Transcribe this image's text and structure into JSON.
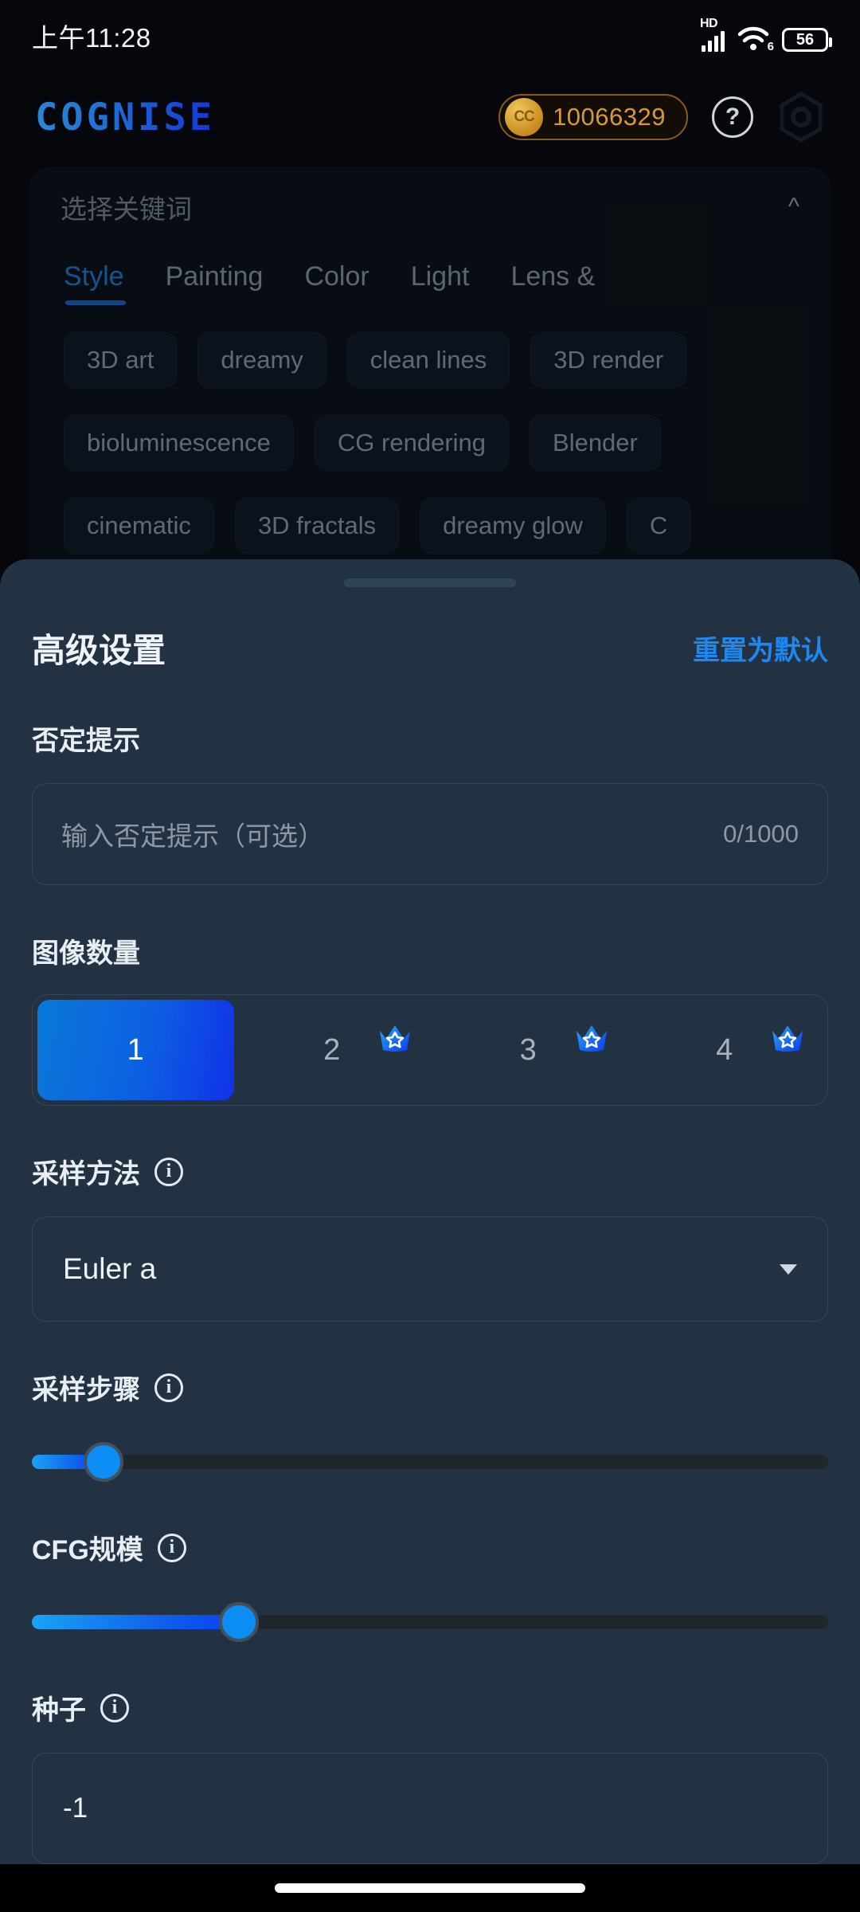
{
  "status_bar": {
    "time": "上午11:28",
    "network_label": "HD",
    "wifi_generation": "6",
    "battery_percent": "56"
  },
  "app_bar": {
    "logo": "COGNISE",
    "coin_icon_label": "CC",
    "coin_balance": "10066329",
    "help_label": "?",
    "icons": [
      "coin-icon",
      "help-icon",
      "settings-hex-icon"
    ]
  },
  "background_panel": {
    "title": "选择关键词",
    "collapse_icon": "chevron-up-icon",
    "tabs": [
      {
        "label": "Style",
        "active": true
      },
      {
        "label": "Painting",
        "active": false
      },
      {
        "label": "Color",
        "active": false
      },
      {
        "label": "Light",
        "active": false
      },
      {
        "label": "Lens &",
        "active": false
      }
    ],
    "chip_rows": [
      [
        "3D art",
        "dreamy",
        "clean lines",
        "3D render"
      ],
      [
        "bioluminescence",
        "CG rendering",
        "Blender"
      ],
      [
        "cinematic",
        "3D fractals",
        "dreamy glow",
        "C"
      ]
    ]
  },
  "sheet": {
    "title": "高级设置",
    "reset_label": "重置为默认",
    "negative_prompt": {
      "label": "否定提示",
      "placeholder": "输入否定提示（可选）",
      "counter": "0/1000",
      "value": ""
    },
    "image_count": {
      "label": "图像数量",
      "options": [
        {
          "value": "1",
          "selected": true,
          "premium": false
        },
        {
          "value": "2",
          "selected": false,
          "premium": true
        },
        {
          "value": "3",
          "selected": false,
          "premium": true
        },
        {
          "value": "4",
          "selected": false,
          "premium": true
        }
      ]
    },
    "sampling_method": {
      "label": "采样方法",
      "info_icon": "info-icon",
      "value": "Euler a",
      "caret_icon": "chevron-down-icon"
    },
    "sampling_steps": {
      "label": "采样步骤",
      "info_icon": "info-icon",
      "percent": 9
    },
    "cfg_scale": {
      "label": "CFG规模",
      "info_icon": "info-icon",
      "percent": 26
    },
    "seed": {
      "label": "种子",
      "info_icon": "info-icon",
      "value": "-1"
    }
  },
  "colors": {
    "sheet_bg": "#233242",
    "accent_blue": "#1e88f0",
    "coin_gold": "#d79a33",
    "page_bg": "#05070c"
  }
}
